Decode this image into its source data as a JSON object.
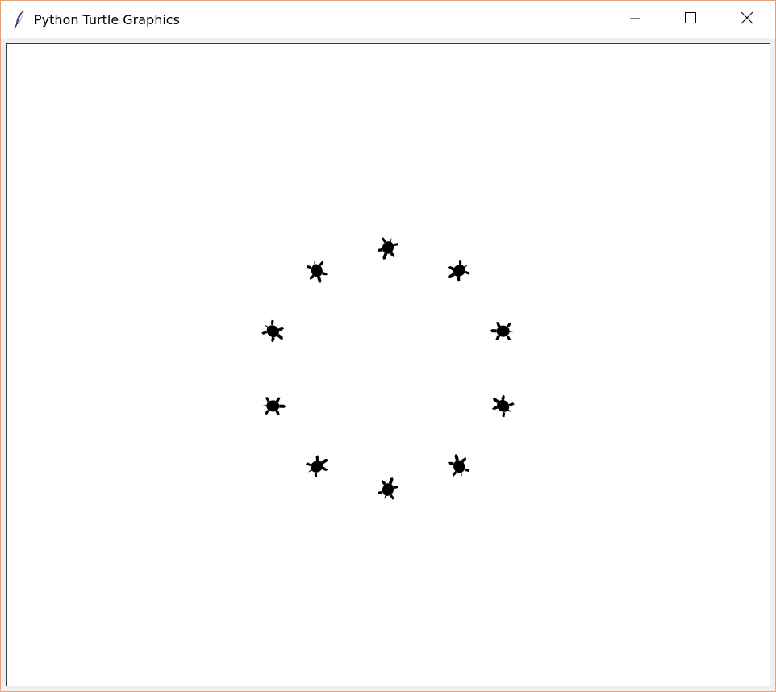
{
  "window": {
    "title": "Python Turtle Graphics",
    "icon": "feather-icon",
    "controls": {
      "minimize_icon": "minimize-icon",
      "maximize_icon": "maximize-icon",
      "close_icon": "close-icon"
    }
  },
  "canvas": {
    "background": "#ffffff",
    "turtle_color": "#000000",
    "turtle_count": 10,
    "turtle_shape": "turtle"
  }
}
